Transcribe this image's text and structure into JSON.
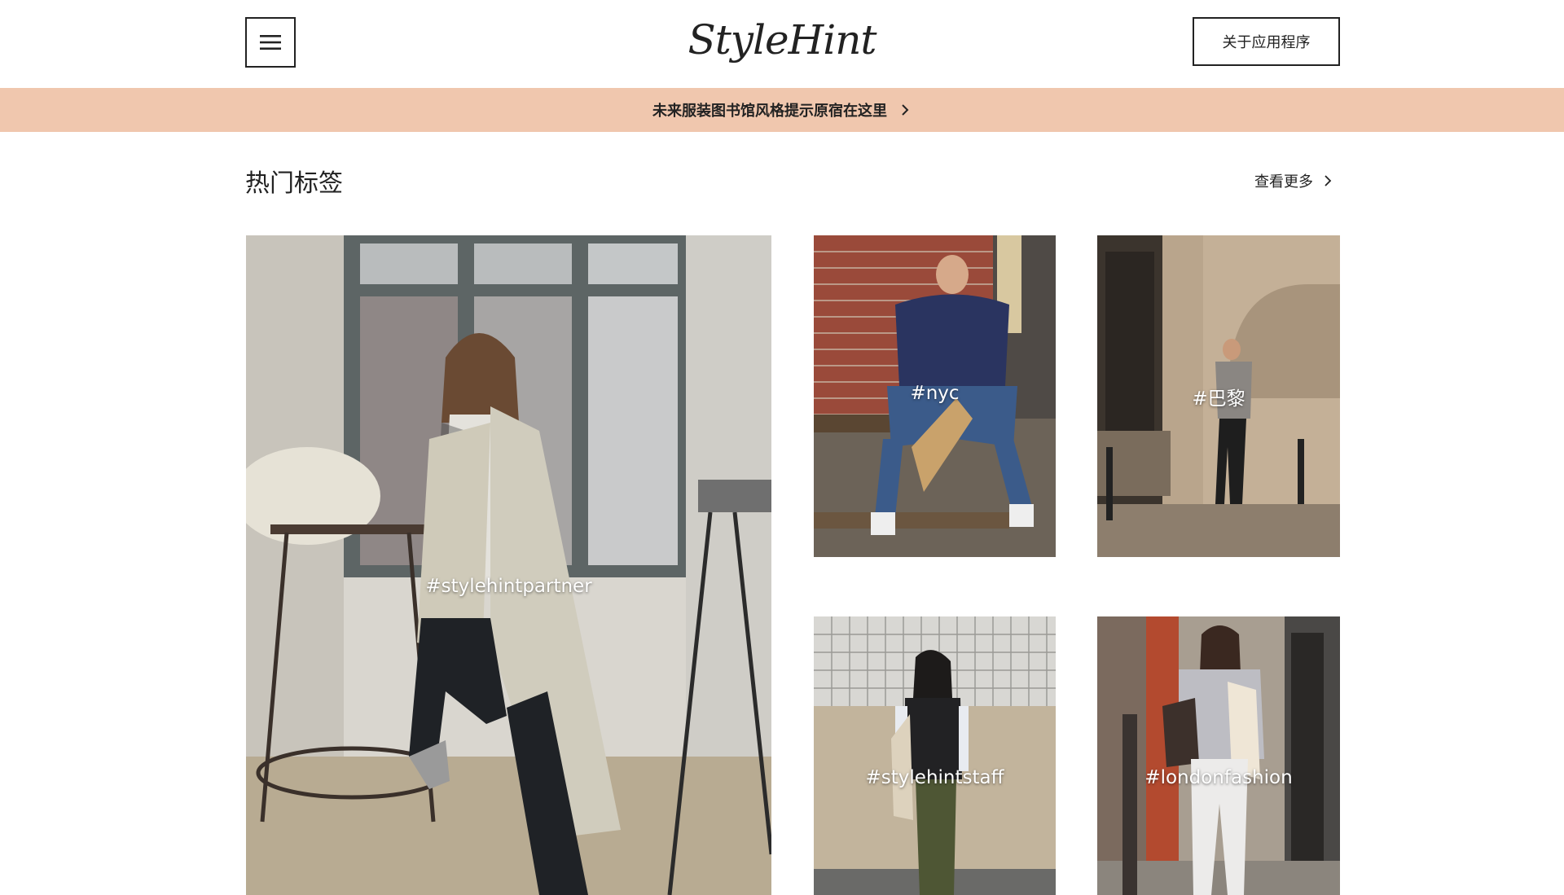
{
  "header": {
    "menu_icon": "hamburger-menu-icon",
    "logo_text": "StyleHint",
    "about_button_label": "关于应用程序"
  },
  "banner": {
    "text": "未来服装图书馆风格提示原宿在这里",
    "icon": "chevron-right-icon",
    "background_color": "#f0c7ae"
  },
  "section": {
    "title": "热门标签",
    "see_more_label": "查看更多",
    "see_more_icon": "chevron-right-icon"
  },
  "tiles": [
    {
      "tag": "#stylehintpartner"
    },
    {
      "tag": "#nyc"
    },
    {
      "tag": "#巴黎"
    },
    {
      "tag": "#stylehintstaff"
    },
    {
      "tag": "#londonfashion"
    }
  ]
}
